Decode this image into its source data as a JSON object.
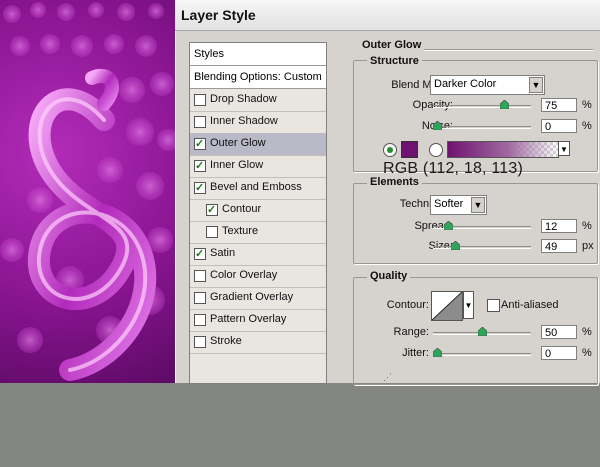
{
  "dialog": {
    "title": "Layer Style"
  },
  "styles_list": {
    "header": "Styles",
    "blending": "Blending Options: Custom",
    "items": [
      {
        "label": "Drop Shadow",
        "checked": false,
        "selected": false,
        "indent": false
      },
      {
        "label": "Inner Shadow",
        "checked": false,
        "selected": false,
        "indent": false
      },
      {
        "label": "Outer Glow",
        "checked": true,
        "selected": true,
        "indent": false
      },
      {
        "label": "Inner Glow",
        "checked": true,
        "selected": false,
        "indent": false
      },
      {
        "label": "Bevel and Emboss",
        "checked": true,
        "selected": false,
        "indent": false
      },
      {
        "label": "Contour",
        "checked": true,
        "selected": false,
        "indent": true
      },
      {
        "label": "Texture",
        "checked": false,
        "selected": false,
        "indent": true
      },
      {
        "label": "Satin",
        "checked": true,
        "selected": false,
        "indent": false
      },
      {
        "label": "Color Overlay",
        "checked": false,
        "selected": false,
        "indent": false
      },
      {
        "label": "Gradient Overlay",
        "checked": false,
        "selected": false,
        "indent": false
      },
      {
        "label": "Pattern Overlay",
        "checked": false,
        "selected": false,
        "indent": false
      },
      {
        "label": "Stroke",
        "checked": false,
        "selected": false,
        "indent": false
      }
    ]
  },
  "outer_glow": {
    "title": "Outer Glow",
    "structure": {
      "title": "Structure",
      "blend_mode_label": "Blend Mode:",
      "blend_mode_value": "Darker Color",
      "opacity_label": "Opacity:",
      "opacity_value": "75",
      "opacity_level": 75,
      "noise_label": "Noise:",
      "noise_value": "0",
      "noise_level": 0,
      "percent": "%",
      "glow_color": "#701271",
      "rgb_label": "RGB (112, 18, 113)"
    },
    "elements": {
      "title": "Elements",
      "technique_label": "Technique:",
      "technique_value": "Softer",
      "spread_label": "Spread:",
      "spread_value": "12",
      "spread_level": 12,
      "size_label": "Size:",
      "size_value": "49",
      "size_level": 20,
      "percent": "%",
      "px": "px"
    },
    "quality": {
      "title": "Quality",
      "contour_label": "Contour:",
      "anti_aliased_label": "Anti-aliased",
      "range_label": "Range:",
      "range_value": "50",
      "range_level": 50,
      "jitter_label": "Jitter:",
      "jitter_value": "0",
      "jitter_level": 0,
      "percent": "%"
    }
  },
  "colors": {
    "accent": "#701271",
    "dialog_bg": "#d6d3ce",
    "bg_gray": "#838683"
  }
}
